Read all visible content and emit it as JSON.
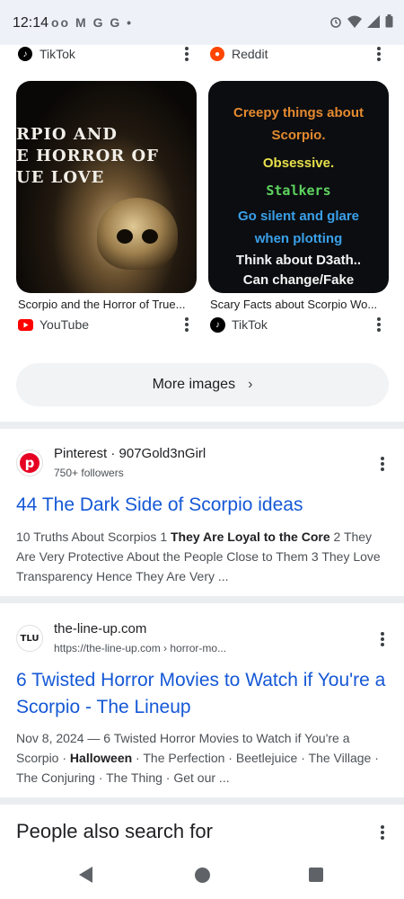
{
  "status_bar": {
    "time": "12:14",
    "left_icons": [
      "voicemail-icon",
      "gmail-icon",
      "google-icon",
      "google-icon",
      "dot-icon"
    ],
    "right_icons": [
      "alarm-icon",
      "wifi-icon",
      "signal-icon",
      "battery-icon"
    ]
  },
  "image_results": {
    "top_sources": [
      {
        "name": "TikTok",
        "icon": "tiktok-icon"
      },
      {
        "name": "Reddit",
        "icon": "reddit-icon"
      }
    ],
    "cards": [
      {
        "image_text": [
          "RPIO AND",
          "E HORROR OF",
          "UE LOVE"
        ],
        "caption": "Scorpio and the Horror of True...",
        "source": "YouTube",
        "source_icon": "youtube-icon"
      },
      {
        "image_lines": [
          {
            "text": "Creepy things about",
            "color": "#e58a2e"
          },
          {
            "text": "Scorpio.",
            "color": "#e58a2e"
          },
          {
            "text": "Obsessive.",
            "color": "#e8e04a"
          },
          {
            "text": "Stalkers",
            "color": "#5ed35e"
          },
          {
            "text": "Go silent and glare",
            "color": "#3aa0e8"
          },
          {
            "text": "when plotting",
            "color": "#3aa0e8"
          },
          {
            "text": "Think about D3ath..",
            "color": "#f4f4f4"
          },
          {
            "text": "Can change/Fake",
            "color": "#f4f4f4"
          }
        ],
        "caption": "Scary Facts about Scorpio Wo...",
        "source": "TikTok",
        "source_icon": "tiktok-icon"
      }
    ],
    "more_images_label": "More images"
  },
  "results": [
    {
      "site": "Pinterest · 907Gold3nGirl",
      "sub": "750+ followers",
      "icon": "pinterest-icon",
      "title": "44 The Dark Side of Scorpio ideas",
      "snippet_parts": [
        {
          "text": "10 Truths About Scorpios 1 ",
          "bold": false
        },
        {
          "text": "They Are Loyal to the Core",
          "bold": true
        },
        {
          "text": " 2 They Are Very Protective About the People Close to Them 3 They Love Transparency Hence They Are Very ...",
          "bold": false
        }
      ]
    },
    {
      "site": "the-line-up.com",
      "sub": "https://the-line-up.com › horror-mo...",
      "icon_text": "TLU",
      "title": "6 Twisted Horror Movies to Watch if You're a Scorpio - The Lineup",
      "snippet_parts": [
        {
          "text": "Nov 8, 2024 — 6 Twisted Horror Movies to Watch if You're a Scorpio · ",
          "bold": false
        },
        {
          "text": "Halloween",
          "bold": true
        },
        {
          "text": " · The Perfection · Beetlejuice · The Village · The Conjuring · The Thing · Get our ...",
          "bold": false
        }
      ]
    }
  ],
  "people_also_search": "People also search for",
  "colors": {
    "link": "#1558d6",
    "status_bar_bg": "#eef1f8",
    "divider": "#ebedf0"
  }
}
